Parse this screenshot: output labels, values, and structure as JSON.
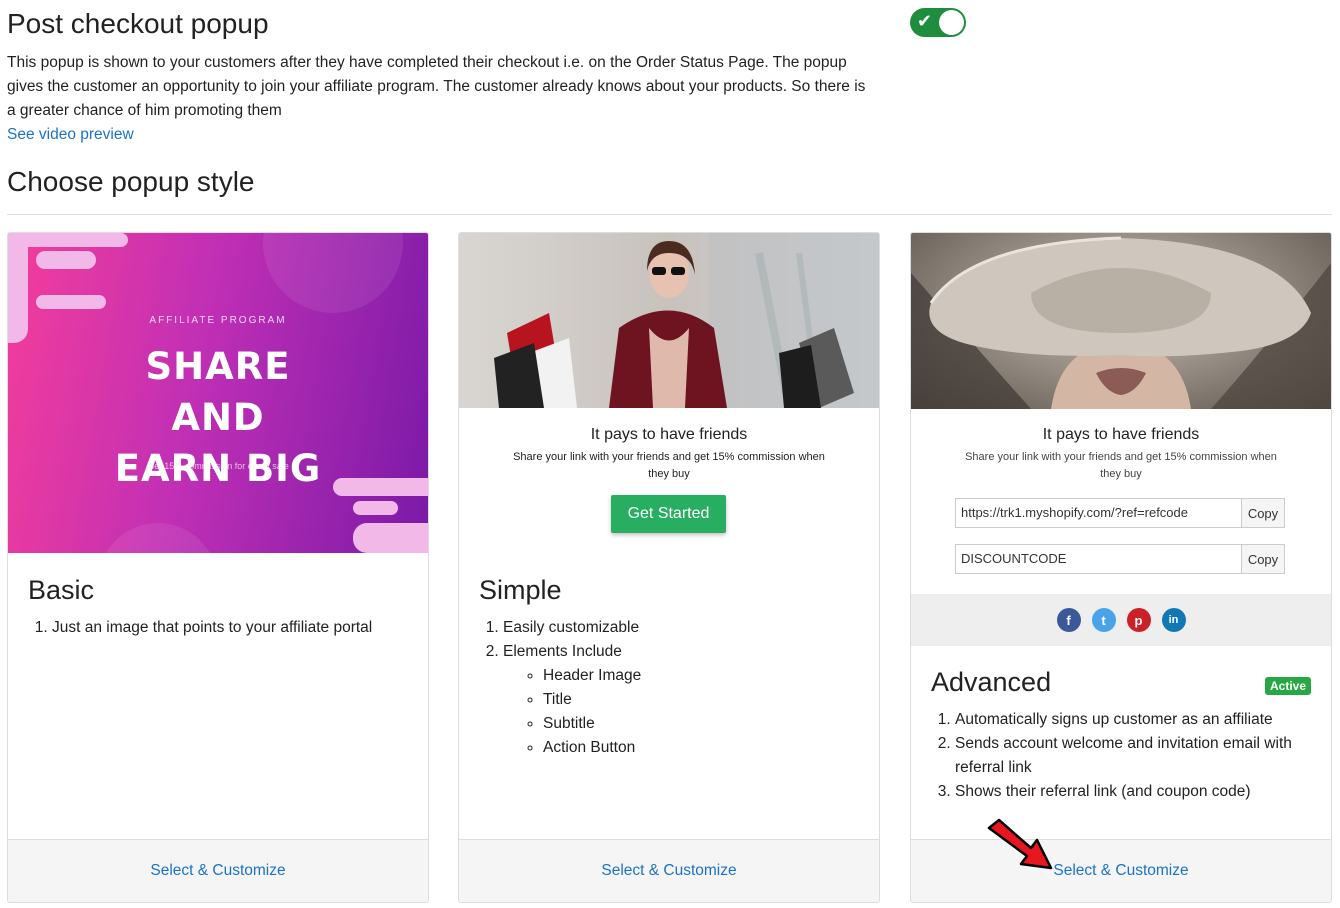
{
  "header": {
    "title": "Post checkout popup",
    "description": "This popup is shown to your customers after they have completed their checkout i.e. on the Order Status Page. The popup gives the customer an opportunity to join your affiliate program. The customer already knows about your products. So there is a greater chance of him promoting them",
    "video_link": "See video preview",
    "toggle_on": true
  },
  "section_title": "Choose popup style",
  "cards": [
    {
      "name": "Basic",
      "preview": {
        "label": "AFFILIATE PROGRAM",
        "headline_1": "SHARE",
        "headline_2": "AND",
        "headline_3": "EARN BIG",
        "note": "Get 15% commission for every sale"
      },
      "items": [
        "Just an image that points to your affiliate portal"
      ],
      "action": "Select & Customize"
    },
    {
      "name": "Simple",
      "preview": {
        "title": "It pays to have friends",
        "subtitle": "Share your link with your friends and get 15% commission when they buy",
        "button": "Get Started"
      },
      "items": [
        "Easily customizable",
        "Elements Include"
      ],
      "sub_items": [
        "Header Image",
        "Title",
        "Subtitle",
        "Action Button"
      ],
      "action": "Select & Customize"
    },
    {
      "name": "Advanced",
      "badge": "Active",
      "preview": {
        "title": "It pays to have friends",
        "subtitle": "Share your link with your friends and get 15% commission when they buy",
        "link_value": "https://trk1.myshopify.com/?ref=refcode",
        "code_value": "DISCOUNTCODE",
        "copy_label": "Copy",
        "social": [
          "f",
          "t",
          "p",
          "in"
        ]
      },
      "items": [
        "Automatically signs up customer as an affiliate",
        "Sends account welcome and invitation email with referral link",
        "Shows their referral link (and coupon code)"
      ],
      "action": "Select & Customize"
    }
  ],
  "colors": {
    "accent_link": "#1a73c9",
    "toggle_on": "#1e8e3e",
    "active_badge": "#28a745",
    "get_started": "#27ae60",
    "annotation_arrow": "#e8171f"
  }
}
